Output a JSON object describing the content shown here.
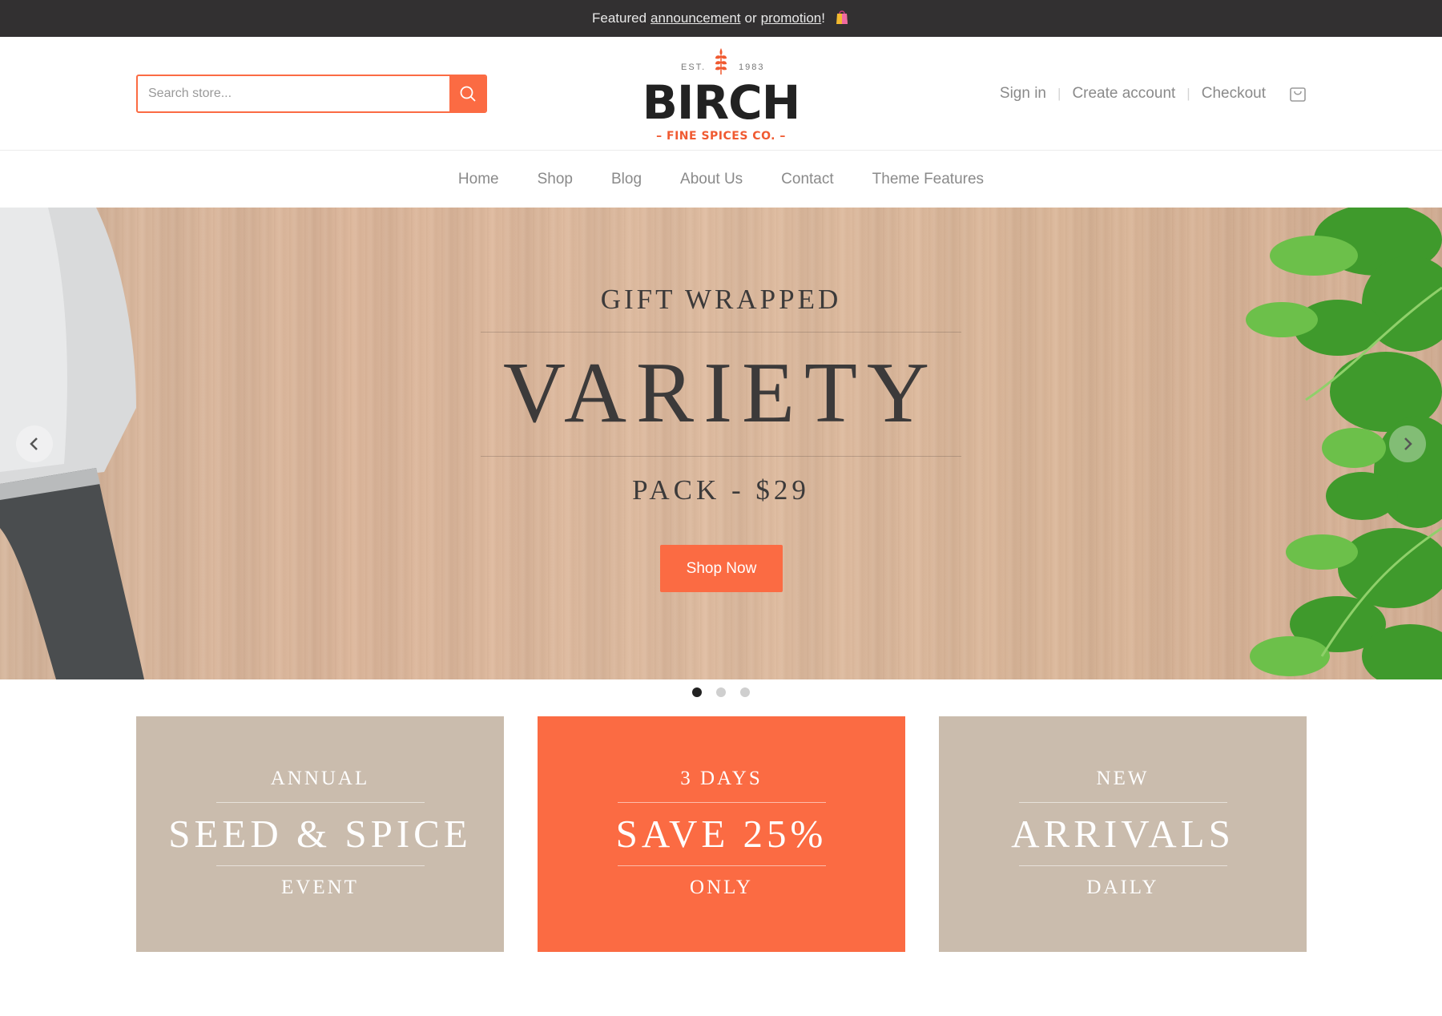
{
  "announcement": {
    "prefix": "Featured",
    "link1": "announcement",
    "middle": "or",
    "link2": "promotion",
    "suffix": "!",
    "icon": "shopping-bag-icon"
  },
  "search": {
    "placeholder": "Search store...",
    "value": "",
    "button_icon": "search-icon"
  },
  "logo": {
    "est_left": "EST.",
    "est_right": "1983",
    "name": "BIRCH",
    "tagline": "– FINE SPICES CO. –",
    "icon": "wheat-icon"
  },
  "account": {
    "sign_in": "Sign in",
    "separator": "|",
    "create_account": "Create account",
    "checkout": "Checkout",
    "cart_icon": "cart-icon"
  },
  "nav": {
    "items": [
      {
        "label": "Home"
      },
      {
        "label": "Shop"
      },
      {
        "label": "Blog"
      },
      {
        "label": "About Us"
      },
      {
        "label": "Contact"
      },
      {
        "label": "Theme Features"
      }
    ]
  },
  "hero": {
    "kicker": "GIFT WRAPPED",
    "headline": "VARIETY",
    "sub": "PACK - $29",
    "button": "Shop Now",
    "prev_icon": "chevron-left-icon",
    "next_icon": "chevron-right-icon",
    "slides_total": 3,
    "slide_active": 1
  },
  "tiles": [
    {
      "top": "ANNUAL",
      "main": "SEED & SPICE",
      "bottom": "EVENT",
      "color": "#cabcad"
    },
    {
      "top": "3 DAYS",
      "main": "SAVE 25%",
      "bottom": "ONLY",
      "color": "#fb6b43"
    },
    {
      "top": "NEW",
      "main": "ARRIVALS",
      "bottom": "DAILY",
      "color": "#cabcad"
    }
  ],
  "colors": {
    "accent": "#fb6b43",
    "announcement_bg": "#323031",
    "tile_neutral": "#cabcad"
  }
}
